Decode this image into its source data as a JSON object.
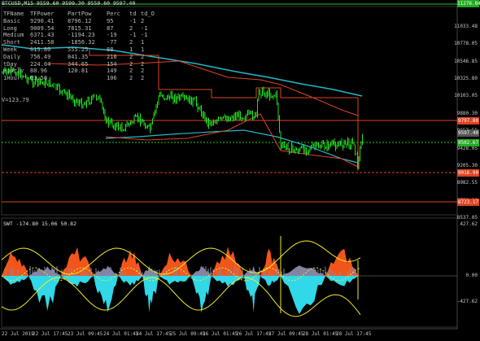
{
  "chart_title": "BTCUSD,M15 9559.60 9599.30 9559.60 9597.40",
  "table": {
    "headers": [
      "TFName",
      "TFPower",
      "PartPow",
      "Perc",
      "td",
      "td_O"
    ],
    "rows": [
      [
        "Basic",
        "9290.41",
        "8796.12",
        "95",
        "-1",
        "2"
      ],
      [
        "Long",
        "9009.54",
        "7815.31",
        "87",
        "2",
        "-1"
      ],
      [
        "Medium",
        "6371.43",
        "-1194.23",
        "-19",
        "-1",
        "-1"
      ],
      [
        "Short",
        "2411.58",
        "-1856.32",
        "-77",
        "2",
        "1"
      ],
      [
        "Week",
        "615.80",
        "555.25",
        "88",
        "1",
        "1"
      ],
      [
        "Daily",
        "756.49",
        "841.35",
        "216",
        "2",
        "2"
      ],
      [
        "tDay",
        "224.04",
        "344.65",
        "154",
        "2",
        "2"
      ],
      [
        "Hourly",
        "80.96",
        "120.81",
        "149",
        "2",
        "2"
      ],
      [
        "1Hour",
        "63.50",
        "",
        "106",
        "2",
        "2"
      ]
    ]
  },
  "v_line": "V=123.79",
  "indicator_label": "SWT -174.80 15.06 50.82",
  "price_axis": [
    "11033.48",
    "10778.05",
    "10546.85",
    "10325.80",
    "10103.05",
    "9880.30",
    "9657.55",
    "9428.05",
    "9205.30",
    "8982.55",
    "8759.80",
    "8537.05"
  ],
  "price_tags": [
    {
      "text": "11276.84",
      "color": "#22aa22"
    },
    {
      "text": "9797.80",
      "color": "#dd4422"
    },
    {
      "text": "9597.40",
      "color": "#555555"
    },
    {
      "text": "9502.67",
      "color": "#22aa22"
    },
    {
      "text": "9016.90",
      "color": "#dd4422"
    },
    {
      "text": "8723.17",
      "color": "#dd4422"
    }
  ],
  "indicator_axis": [
    "427.62",
    "0.00",
    "-427.62"
  ],
  "x_axis": [
    "22 Jul 2019",
    "22 Jul 17:45",
    "23 Jul 09:45",
    "24 Jul 01:45",
    "24 Jul 17:45",
    "25 Jul 09:45",
    "26 Jul 01:45",
    "26 Jul 17:45",
    "27 Jul 09:45",
    "28 Jul 01:45",
    "28 Jul 17:45"
  ],
  "colors": {
    "candles": "#22dd22",
    "ma_cyan": "#22b8c8",
    "levels_red": "#dd4422",
    "level_green": "#22cc22",
    "osc_orange": "#ff5a1e",
    "osc_cyan": "#30d8e8",
    "osc_yellow": "#f2ea26",
    "osc_gray": "#8a8aa8"
  }
}
